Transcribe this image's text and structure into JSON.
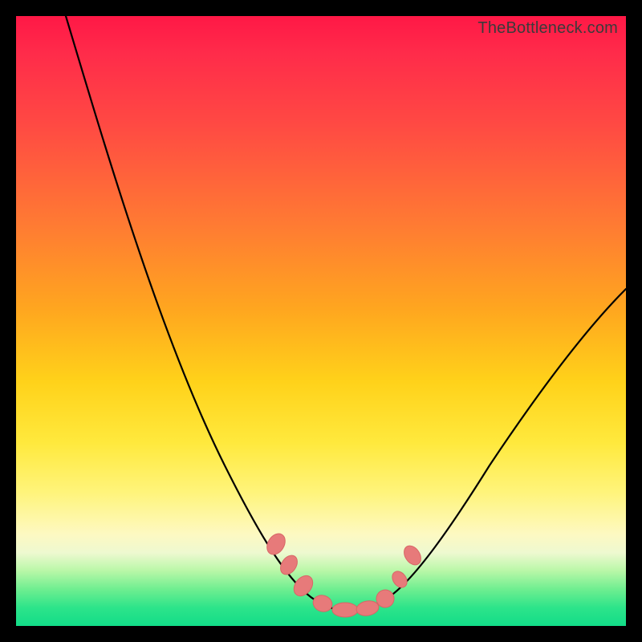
{
  "watermark": "TheBottleneck.com",
  "colors": {
    "gradient_top": "#ff1846",
    "gradient_mid": "#ffd21a",
    "gradient_bottom": "#12dc88",
    "curve": "#000000",
    "marker": "#e77a7a",
    "frame": "#000000"
  },
  "chart_data": {
    "type": "line",
    "title": "",
    "xlabel": "",
    "ylabel": "",
    "xlim": [
      0,
      100
    ],
    "ylim": [
      0,
      100
    ],
    "series": [
      {
        "name": "bottleneck-curve",
        "x": [
          8,
          12,
          16,
          20,
          24,
          28,
          32,
          36,
          40,
          43,
          46,
          49,
          52,
          55,
          58,
          61,
          64,
          68,
          72,
          76,
          82,
          88,
          94,
          100
        ],
        "y": [
          100,
          90,
          80,
          70,
          60,
          50,
          41,
          32,
          23,
          16,
          10,
          6,
          3,
          2,
          2,
          3,
          6,
          12,
          20,
          28,
          38,
          47,
          54,
          60
        ]
      }
    ],
    "markers": {
      "name": "highlight-pills",
      "points": [
        {
          "x": 43,
          "y": 14
        },
        {
          "x": 45,
          "y": 10
        },
        {
          "x": 47,
          "y": 7
        },
        {
          "x": 50,
          "y": 4
        },
        {
          "x": 54,
          "y": 3
        },
        {
          "x": 57,
          "y": 3
        },
        {
          "x": 60,
          "y": 5
        },
        {
          "x": 62,
          "y": 8
        },
        {
          "x": 64,
          "y": 12
        }
      ]
    },
    "notes": "Axes are unlabeled in the source image; x and y values are estimated 0–100 normalized positions read from the plot geometry."
  }
}
